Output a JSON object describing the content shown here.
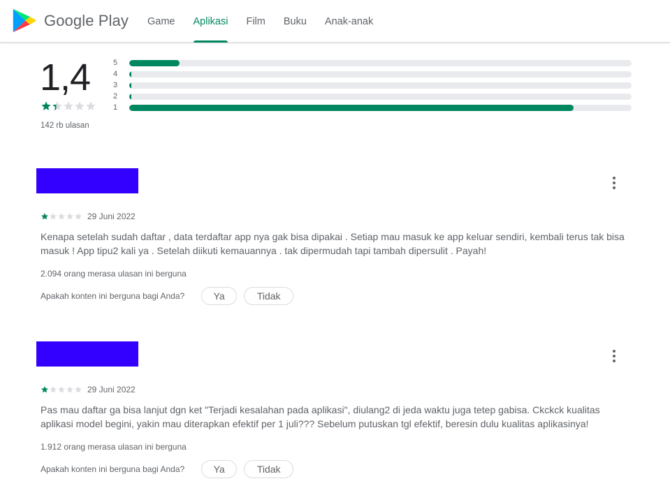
{
  "header": {
    "logo_text": "Google Play",
    "nav": [
      "Game",
      "Aplikasi",
      "Film",
      "Buku",
      "Anak-anak"
    ],
    "active_nav": "Aplikasi"
  },
  "summary": {
    "rating": "1,4",
    "rating_value": 1.4,
    "review_count": "142 rb ulasan",
    "histogram": [
      {
        "label": "5",
        "fraction": 0.1
      },
      {
        "label": "4",
        "fraction": 0.004
      },
      {
        "label": "3",
        "fraction": 0.004
      },
      {
        "label": "2",
        "fraction": 0.004
      },
      {
        "label": "1",
        "fraction": 0.885
      }
    ]
  },
  "reviews": [
    {
      "rating": 1,
      "date": "29 Juni 2022",
      "text": "Kenapa setelah sudah daftar , data terdaftar app nya gak bisa dipakai . Setiap mau masuk ke app keluar sendiri, kembali terus tak bisa masuk ! App tipu2 kali ya . Setelah diikuti kemauannya . tak dipermudah tapi tambah dipersulit . Payah!",
      "helpful": "2.094 orang merasa ulasan ini berguna",
      "question": "Apakah konten ini berguna bagi Anda?",
      "yes": "Ya",
      "no": "Tidak"
    },
    {
      "rating": 1,
      "date": "29 Juni 2022",
      "text": "Pas mau daftar ga bisa lanjut dgn ket \"Terjadi kesalahan pada aplikasi\", diulang2 di jeda waktu juga tetep gabisa. Ckckck kualitas aplikasi model begini, yakin mau diterapkan efektif per 1 juli??? Sebelum putuskan tgl efektif, beresin dulu kualitas aplikasinya!",
      "helpful": "1.912 orang merasa ulasan ini berguna",
      "question": "Apakah konten ini berguna bagi Anda?",
      "yes": "Ya",
      "no": "Tidak"
    }
  ],
  "colors": {
    "accent": "#01875f",
    "redaction": "#3300ff",
    "star_empty": "#dadce0"
  }
}
